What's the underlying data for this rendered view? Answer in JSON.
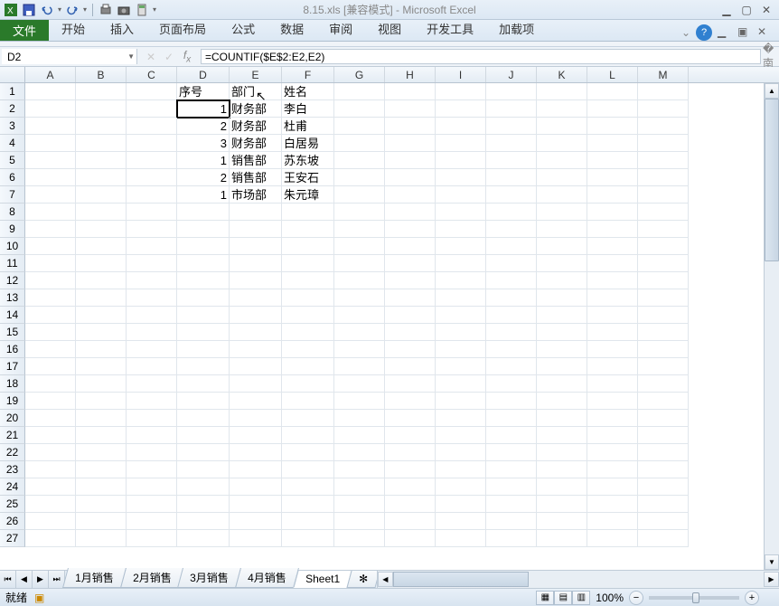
{
  "title": "8.15.xls [兼容模式] - Microsoft Excel",
  "tabs": {
    "file": "文件",
    "items": [
      "开始",
      "插入",
      "页面布局",
      "公式",
      "数据",
      "审阅",
      "视图",
      "开发工具",
      "加载项"
    ]
  },
  "namebox": "D2",
  "formula": "=COUNTIF($E$2:E2,E2)",
  "columns": [
    "A",
    "B",
    "C",
    "D",
    "E",
    "F",
    "G",
    "H",
    "I",
    "J",
    "K",
    "L",
    "M"
  ],
  "row_count": 27,
  "cells": {
    "D1": "序号",
    "E1": "部门",
    "F1": "姓名",
    "D2": "1",
    "E2": "财务部",
    "F2": "李白",
    "D3": "2",
    "E3": "财务部",
    "F3": "杜甫",
    "D4": "3",
    "E4": "财务部",
    "F4": "白居易",
    "D5": "1",
    "E5": "销售部",
    "F5": "苏东坡",
    "D6": "2",
    "E6": "销售部",
    "F6": "王安石",
    "D7": "1",
    "E7": "市场部",
    "F7": "朱元璋"
  },
  "selected_cell": "D2",
  "sheets": [
    "1月销售",
    "2月销售",
    "3月销售",
    "4月销售",
    "Sheet1"
  ],
  "active_sheet": "Sheet1",
  "status": "就绪",
  "zoom": "100%",
  "chart_data": null
}
